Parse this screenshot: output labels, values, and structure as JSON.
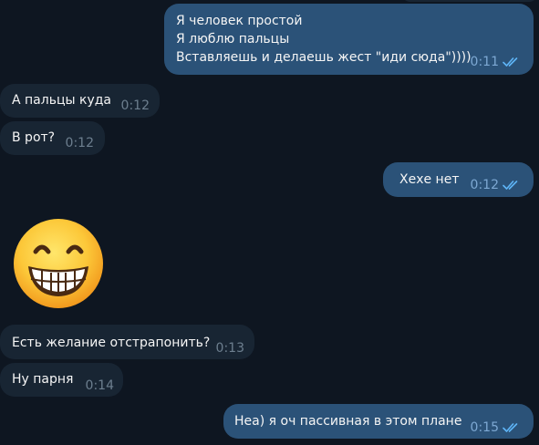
{
  "chat": {
    "messages": [
      {
        "direction": "out",
        "lines": [
          "Я человек простой",
          "Я люблю пальцы",
          "Вставляешь и делаешь жест \"иди сюда\"))))"
        ],
        "time": "0:11",
        "read": true
      },
      {
        "direction": "in",
        "text": "А пальцы куда",
        "time": "0:12"
      },
      {
        "direction": "in",
        "text": "В рот?",
        "time": "0:12"
      },
      {
        "direction": "out",
        "text": "Хехе нет",
        "time": "0:12",
        "read": true
      },
      {
        "direction": "in",
        "type": "sticker",
        "sticker": "grinning-face-with-smiling-eyes"
      },
      {
        "direction": "in",
        "text": "Есть желание отстрапонить?",
        "time": "0:13"
      },
      {
        "direction": "in",
        "text": "Ну парня",
        "time": "0:14"
      },
      {
        "direction": "out",
        "text": "Неа) я оч пассивная в этом плане",
        "time": "0:15",
        "read": true
      }
    ]
  },
  "colors": {
    "background": "#0e1621",
    "incoming_bubble": "#182533",
    "outgoing_bubble": "#2b5278",
    "read_check": "#5eb5f7"
  },
  "icons": {
    "read_status": "double-check-icon"
  }
}
